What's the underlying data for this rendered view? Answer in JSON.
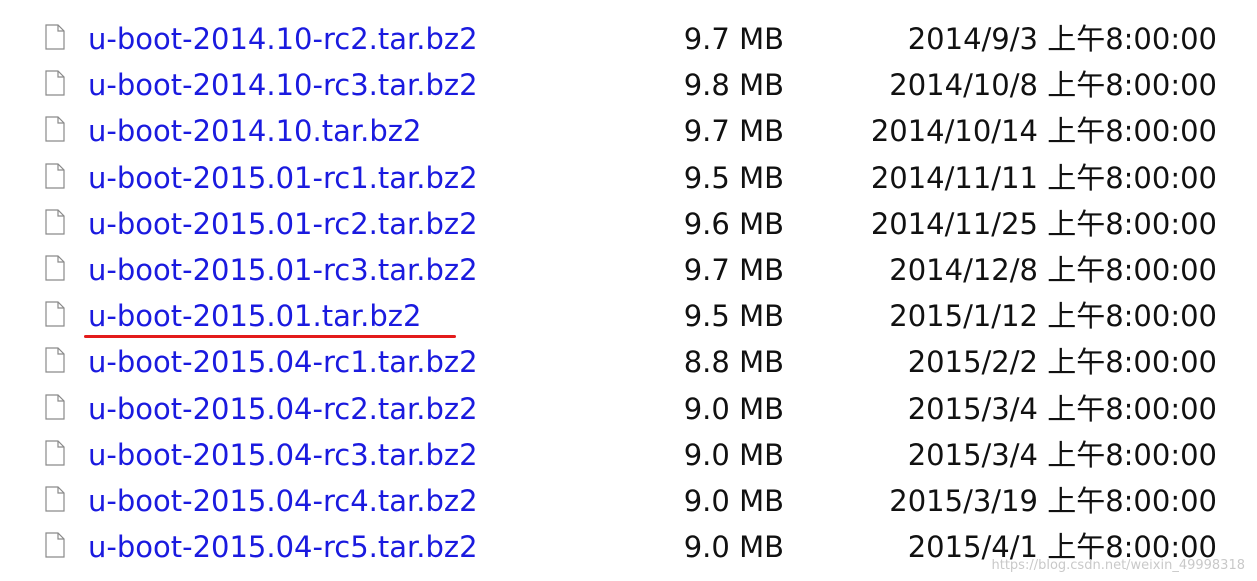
{
  "files": [
    {
      "name": "u-boot-2014.10-rc2.tar.bz2",
      "size": "9.7 MB",
      "date": "2014/9/3 上午8:00:00"
    },
    {
      "name": "u-boot-2014.10-rc3.tar.bz2",
      "size": "9.8 MB",
      "date": "2014/10/8 上午8:00:00"
    },
    {
      "name": "u-boot-2014.10.tar.bz2",
      "size": "9.7 MB",
      "date": "2014/10/14 上午8:00:00"
    },
    {
      "name": "u-boot-2015.01-rc1.tar.bz2",
      "size": "9.5 MB",
      "date": "2014/11/11 上午8:00:00"
    },
    {
      "name": "u-boot-2015.01-rc2.tar.bz2",
      "size": "9.6 MB",
      "date": "2014/11/25 上午8:00:00"
    },
    {
      "name": "u-boot-2015.01-rc3.tar.bz2",
      "size": "9.7 MB",
      "date": "2014/12/8 上午8:00:00"
    },
    {
      "name": "u-boot-2015.01.tar.bz2",
      "size": "9.5 MB",
      "date": "2015/1/12 上午8:00:00",
      "highlighted": true
    },
    {
      "name": "u-boot-2015.04-rc1.tar.bz2",
      "size": "8.8 MB",
      "date": "2015/2/2 上午8:00:00"
    },
    {
      "name": "u-boot-2015.04-rc2.tar.bz2",
      "size": "9.0 MB",
      "date": "2015/3/4 上午8:00:00"
    },
    {
      "name": "u-boot-2015.04-rc3.tar.bz2",
      "size": "9.0 MB",
      "date": "2015/3/4 上午8:00:00"
    },
    {
      "name": "u-boot-2015.04-rc4.tar.bz2",
      "size": "9.0 MB",
      "date": "2015/3/19 上午8:00:00"
    },
    {
      "name": "u-boot-2015.04-rc5.tar.bz2",
      "size": "9.0 MB",
      "date": "2015/4/1 上午8:00:00"
    }
  ],
  "icon": "file-icon",
  "colors": {
    "link": "#1a1adf",
    "text": "#111111",
    "highlight_underline": "#e31b1b"
  },
  "watermark": "https://blog.csdn.net/weixin_49998318"
}
